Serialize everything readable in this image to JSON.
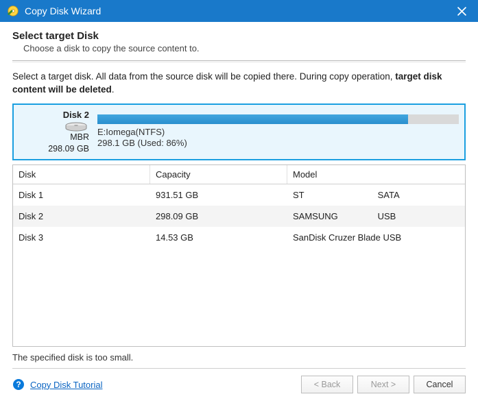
{
  "titlebar": {
    "title": "Copy Disk Wizard"
  },
  "page": {
    "heading": "Select target Disk",
    "subheading": "Choose a disk to copy the source content to.",
    "instruction_prefix": "Select a target disk. All data from the source disk will be copied there. During copy operation, ",
    "instruction_bold": "target disk content will be deleted",
    "instruction_suffix": "."
  },
  "selected_disk": {
    "name": "Disk 2",
    "scheme": "MBR",
    "capacity": "298.09 GB",
    "partition_label": "E:Iomega(NTFS)",
    "partition_usage": "298.1 GB (Used: 86%)",
    "usage_percent": 86
  },
  "table": {
    "headers": {
      "disk": "Disk",
      "capacity": "Capacity",
      "model": "Model"
    },
    "rows": [
      {
        "disk": "Disk 1",
        "capacity": "931.51 GB",
        "model_a": "ST",
        "model_b": "SATA",
        "selected": false
      },
      {
        "disk": "Disk 2",
        "capacity": "298.09 GB",
        "model_a": "SAMSUNG",
        "model_b": "USB",
        "selected": true
      },
      {
        "disk": "Disk 3",
        "capacity": "14.53 GB",
        "model_a": "SanDisk Cruzer Blade USB",
        "model_b": "",
        "selected": false
      }
    ]
  },
  "status_message": "The specified disk is too small.",
  "footer": {
    "tutorial_link": "Copy Disk Tutorial",
    "back": "< Back",
    "next": "Next >",
    "cancel": "Cancel"
  },
  "colors": {
    "accent": "#1979ca",
    "selection_border": "#1a9fe0"
  }
}
